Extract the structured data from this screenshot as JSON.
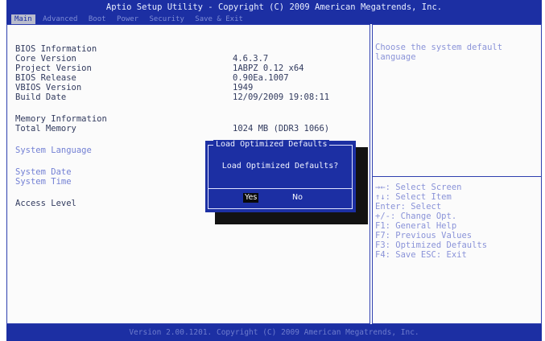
{
  "app": {
    "title": "Aptio Setup Utility - Copyright (C) 2009 American Megatrends, Inc."
  },
  "tabs": [
    "Main",
    "Advanced",
    "Boot",
    "Power",
    "Security",
    "Save & Exit"
  ],
  "main": {
    "rows": [
      {
        "label": "BIOS Information",
        "value": ""
      },
      {
        "label": "Core Version",
        "value": "4.6.3.7"
      },
      {
        "label": "Project Version",
        "value": "1ABPZ 0.12 x64"
      },
      {
        "label": "BIOS Release",
        "value": "0.90Ea.1007"
      },
      {
        "label": "VBIOS Version",
        "value": "1949"
      },
      {
        "label": "Build Date",
        "value": "12/09/2009 19:08:11"
      },
      {
        "label": "Memory Information",
        "value": ""
      },
      {
        "label": "Total Memory",
        "value": "1024 MB (DDR3 1066)"
      },
      {
        "label": "System Language",
        "value": ""
      },
      {
        "label": "System Date",
        "value": ""
      },
      {
        "label": "System Time",
        "value": ""
      },
      {
        "label": "Access Level",
        "value": ""
      }
    ]
  },
  "help": {
    "text": "Choose the system default language",
    "keys": [
      "→←: Select Screen",
      "↑↓: Select Item",
      "Enter: Select",
      "+/-: Change Opt.",
      "F1: General Help",
      "F7: Previous Values",
      "F3: Optimized Defaults",
      "F4: Save  ESC: Exit"
    ]
  },
  "dialog": {
    "title": "Load Optimized Defaults",
    "message": "Load Optimized Defaults?",
    "yes": "Yes",
    "no": "No"
  },
  "footer": "Version 2.00.1201. Copyright (C) 2009 American Megatrends, Inc."
}
